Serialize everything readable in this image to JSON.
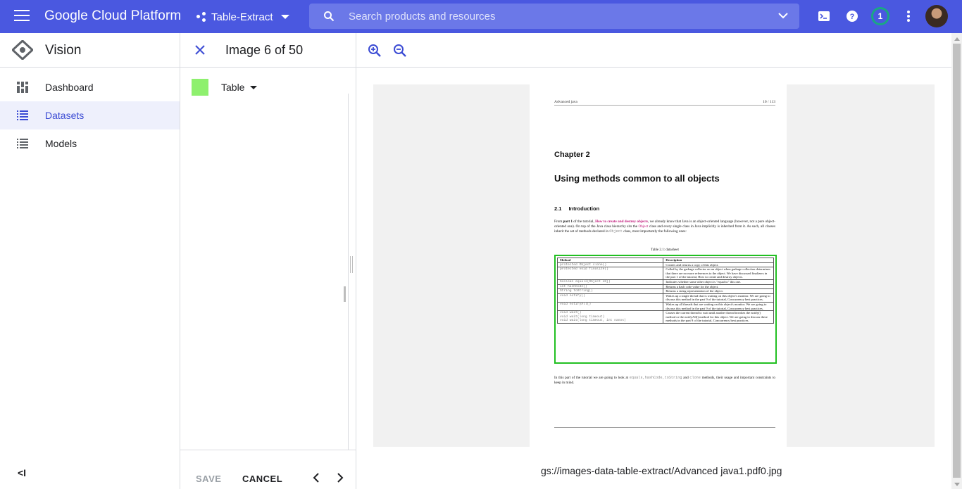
{
  "topbar": {
    "brand": "Google Cloud Platform",
    "project": "Table-Extract",
    "search_placeholder": "Search products and resources",
    "notification_count": "1"
  },
  "leftnav": {
    "title": "Vision",
    "items": [
      {
        "label": "Dashboard",
        "icon": "dashboard-icon"
      },
      {
        "label": "Datasets",
        "icon": "list-icon",
        "active": true
      },
      {
        "label": "Models",
        "icon": "list-icon"
      }
    ],
    "collapse_label": "<I"
  },
  "midpanel": {
    "title": "Image 6 of 50",
    "label_name": "Table",
    "label_color": "#8ef06e",
    "save_label": "SAVE",
    "cancel_label": "CANCEL"
  },
  "document": {
    "header_left": "Advanced java",
    "header_right": "10 / 113",
    "chapter": "Chapter 2",
    "heading": "Using methods common to all objects",
    "section_num": "2.1",
    "section_title": "Introduction",
    "para_a": "From ",
    "para_b": "part 1",
    "para_c": " of the tutorial, ",
    "para_link": "How to create and destroy objects",
    "para_d": ", we already know that Java is an object-oriented language (however, not a pure object-oriented one). On top of the Java class hierarchy sits the ",
    "para_obj": "Object",
    "para_e": " class and every single class in Java implicitly is inherited from it. As such, all classes inherit the set of methods declared in ",
    "para_obj2": "Object",
    "para_f": " class, most importantly the following ones:",
    "table_caption": "Table 2.1: datasheet",
    "table_headers": [
      "Method",
      "Description"
    ],
    "table_rows": [
      {
        "method": "protected Object clone()",
        "desc": "Creates and returns a copy of this object."
      },
      {
        "method": "protected void finalize()",
        "desc": "Called by the garbage collector on an object when garbage collection determines that there are no more references to the object. We have discussed finalizers in the part 1 of the tutorial, How to create and destroy objects."
      },
      {
        "method": "boolean equals(Object obj)",
        "desc": "Indicates whether some other object is \"equal to\" this one."
      },
      {
        "method": "int hashCode()",
        "desc": "Returns a hash code value for the object."
      },
      {
        "method": "String toString()",
        "desc": "Returns a string representation of the object."
      },
      {
        "method": "void notify()",
        "desc": "Wakes up a single thread that is waiting on this object's monitor. We are going to discuss this method in the part 9 of the tutorial, Concurrency best practices."
      },
      {
        "method": "void notifyAll()",
        "desc": "Wakes up all threads that are waiting on this object's monitor. We are going to discuss this method in the part 9 of the tutorial, Concurrency best practices."
      },
      {
        "method": "void wait()\nvoid wait(long timeout)\nvoid wait(long timeout, int nanos)",
        "desc": "Causes the current thread to wait until another thread invokes the notify() method or the notifyAll() method for this object. We are going to discuss these methods in the part 9 of the tutorial, Concurrency best practices."
      }
    ],
    "after_a": "In this part of the tutorial we are going to look at ",
    "after_mono": "equals,hashCode,toString",
    "after_b": " and ",
    "after_mono2": "clone",
    "after_c": " methods, their usage and important constraints to keep in mind."
  },
  "viewer": {
    "gcs_path": "gs://images-data-table-extract/Advanced java1.pdf0.jpg"
  },
  "colors": {
    "topbar": "#4a58e0",
    "accent": "#3b4bd4",
    "bbox_green": "#22c022"
  }
}
